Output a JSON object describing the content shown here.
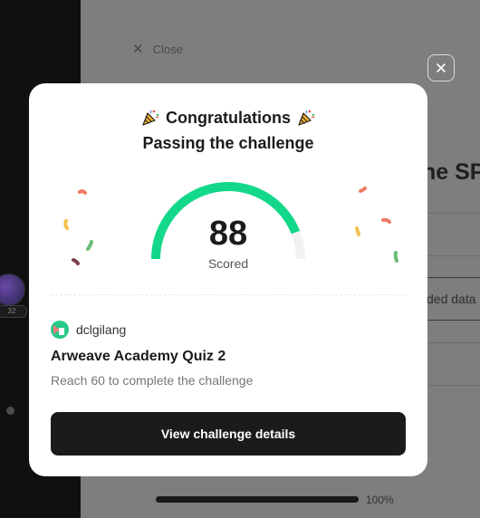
{
  "background": {
    "close_label": "Close",
    "title_fragment": "ne SPe",
    "field_fragment": "ded data",
    "progress_percent": 100,
    "progress_label": "100%",
    "avatar_badge": "32"
  },
  "modal": {
    "heading": "Congratulations",
    "subheading": "Passing the challenge",
    "score": "88",
    "score_max": 100,
    "score_label": "Scored",
    "username": "dclgilang",
    "quiz_title": "Arweave Academy Quiz 2",
    "requirement": "Reach 60 to complete the challenge",
    "cta_label": "View challenge details"
  },
  "colors": {
    "gauge_fill": "#13d88a",
    "gauge_track": "#f2f2f2",
    "button_bg": "#1b1b1b",
    "modal_bg": "#ffffff"
  },
  "icons": {
    "heading_left": "party-popper-icon",
    "heading_right": "party-popper-icon",
    "overlay_close": "close-icon"
  }
}
